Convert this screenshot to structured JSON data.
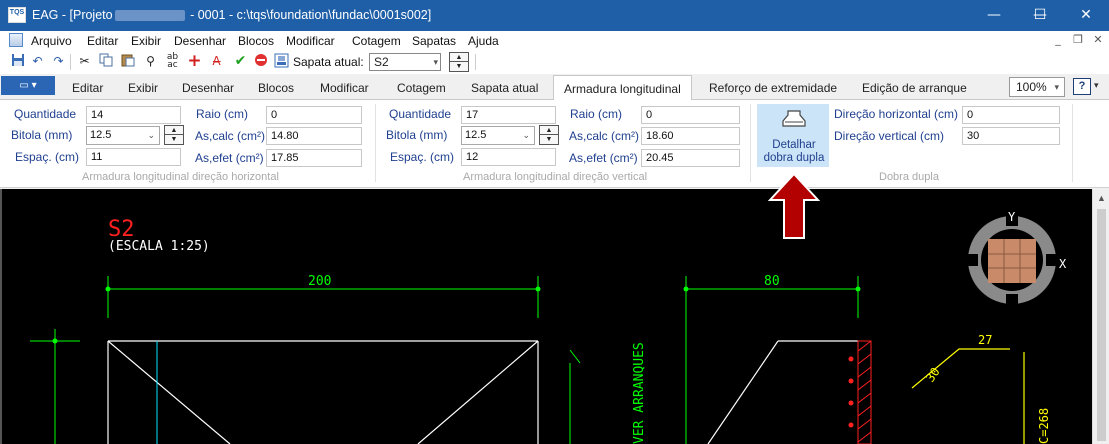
{
  "window": {
    "app_icon_text": "TQS",
    "title_prefix": "EAG - [Projeto",
    "title_suffix": " - 0001 - c:\\tqs\\foundation\\fundac\\0001s002]",
    "minimize": "—",
    "maximize": "☐",
    "close": "✕"
  },
  "menu": {
    "items": [
      "Arquivo",
      "Editar",
      "Exibir",
      "Desenhar",
      "Blocos",
      "Modificar",
      "Cotagem",
      "Sapatas",
      "Ajuda"
    ],
    "mdi_min": "_",
    "mdi_restore": "❐",
    "mdi_close": "✕"
  },
  "toolbar": {
    "sapata_label": "Sapata atual:",
    "sapata_value": "S2"
  },
  "tabs": {
    "items": [
      "Editar",
      "Exibir",
      "Desenhar",
      "Blocos",
      "Modificar",
      "Cotagem",
      "Sapata atual",
      "Armadura longitudinal",
      "Reforço de extremidade",
      "Edição de arranque"
    ],
    "active": "Armadura longitudinal",
    "zoom": "100%",
    "help": "?"
  },
  "horizontal": {
    "quantidade_label": "Quantidade",
    "quantidade": "14",
    "bitola_label": "Bitola (mm)",
    "bitola": "12.5",
    "espac_label": "Espaç. (cm)",
    "espac": "11",
    "raio_label": "Raio (cm)",
    "raio": "0",
    "ascalc_label": "As,calc (cm²)",
    "ascalc": "14.80",
    "asefet_label": "As,efet (cm²)",
    "asefet": "17.85",
    "caption": "Armadura longitudinal direção horizontal"
  },
  "vertical": {
    "quantidade_label": "Quantidade",
    "quantidade": "17",
    "bitola_label": "Bitola (mm)",
    "bitola": "12.5",
    "espac_label": "Espaç. (cm)",
    "espac": "12",
    "raio_label": "Raio (cm)",
    "raio": "0",
    "ascalc_label": "As,calc (cm²)",
    "ascalc": "18.60",
    "asefet_label": "As,efet (cm²)",
    "asefet": "20.45",
    "caption": "Armadura longitudinal direção vertical"
  },
  "dobra": {
    "button_line1": "Detalhar",
    "button_line2": "dobra dupla",
    "dir_h_label": "Direção horizontal (cm)",
    "dir_h": "0",
    "dir_v_label": "Direção vertical (cm)",
    "dir_v": "30",
    "caption": "Dobra dupla"
  },
  "drawing": {
    "title": "S2",
    "scale": "(ESCALA 1:25)",
    "dim_200": "200",
    "dim_80": "80",
    "dim_27": "27",
    "dim_30": "30",
    "dim_c268": "C=268",
    "ver_arranques": "VER ARRANQUES",
    "axis_y": "Y",
    "axis_x": "X"
  },
  "colors": {
    "title_bar": "#1e5fa8",
    "cad_background": "#000000",
    "dim_green": "#00ff00",
    "rebar_yellow": "#ffff00",
    "title_red": "#ff2020",
    "arrow_red": "#b30000"
  }
}
